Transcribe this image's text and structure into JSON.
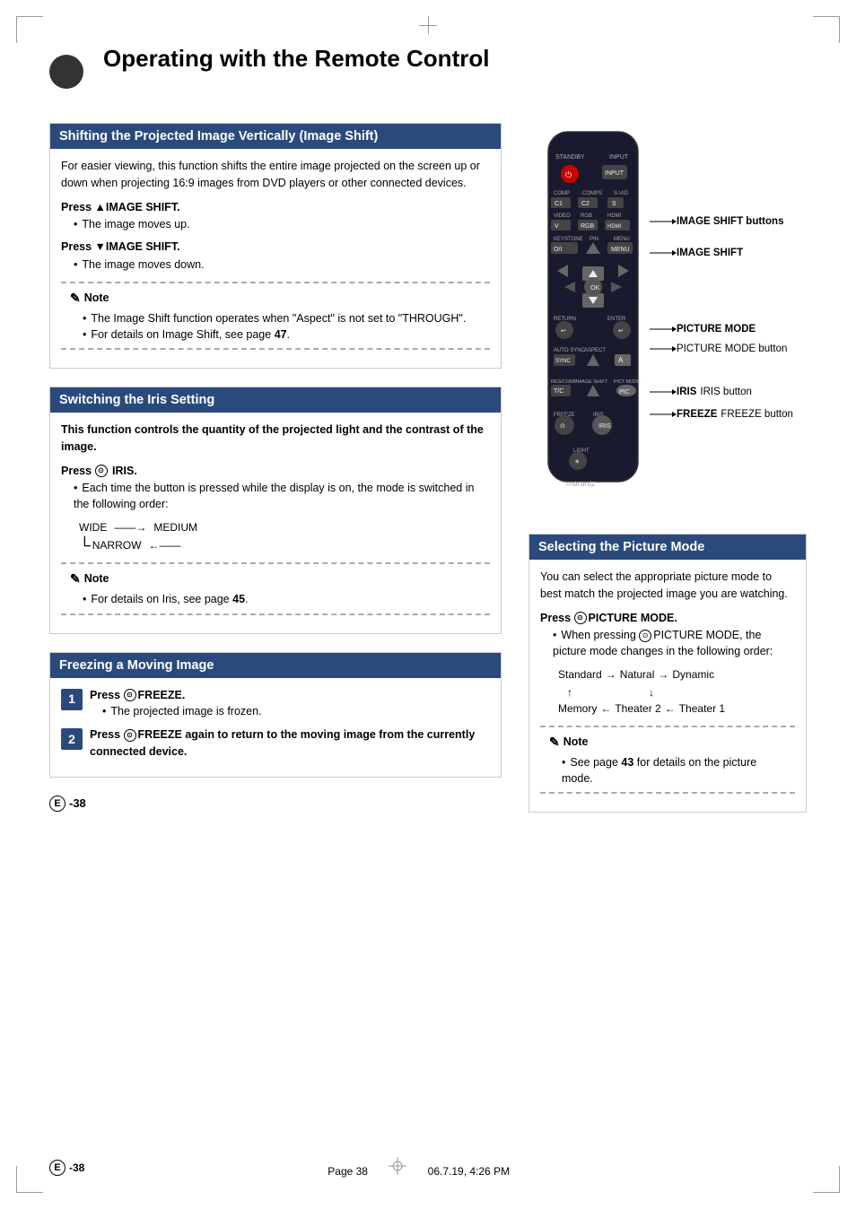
{
  "page": {
    "title": "Operating with the Remote Control",
    "page_num": "38",
    "footer_left": "E -38",
    "footer_center": "Page 38",
    "footer_right": "06.7.19, 4:26 PM"
  },
  "section_image_shift": {
    "header": "Shifting the Projected Image Vertically (Image Shift)",
    "intro": "For easier viewing, this function shifts the entire image projected on the screen up or down when projecting 16:9 images from DVD players or other connected devices.",
    "press_up_label": "Press ▲IMAGE SHIFT.",
    "press_up_bullet": "The image moves up.",
    "press_down_label": "Press ▼IMAGE SHIFT.",
    "press_down_bullet": "The image moves down.",
    "note_header": "Note",
    "note_items": [
      "The Image Shift function operates when \"Aspect\" is not set to \"THROUGH\".",
      "For details on Image Shift, see page 47."
    ]
  },
  "remote_annotations": {
    "image_shift_buttons": "IMAGE SHIFT buttons",
    "image_shift": "IMAGE SHIFT",
    "picture_mode": "PICTURE MODE button",
    "picture_mode_label": "PICTURE",
    "picture_mode_sub": "MODE button",
    "iris": "IRIS",
    "iris_button": "IRIS button",
    "freeze": "FREEZE",
    "freeze_button": "FREEZE button"
  },
  "section_iris": {
    "header": "Switching the Iris Setting",
    "intro_bold": "This function controls the quantity of the projected light and the contrast of the image.",
    "press_label": "Press",
    "press_icon": "IRIS",
    "press_suffix": "IRIS.",
    "bullet": "Each time the button is pressed while the display is on, the mode is switched in the following order:",
    "wide": "WIDE",
    "medium": "MEDIUM",
    "narrow": "NARROW",
    "note_header": "Note",
    "note_items": [
      "For details on Iris, see page 45."
    ]
  },
  "section_freeze": {
    "header": "Freezing a Moving Image",
    "step1_bold": "Press",
    "step1_icon": "FREEZE.",
    "step1_bullet": "The projected image is frozen.",
    "step2_bold": "Press",
    "step2_icon": "FREEZE",
    "step2_suffix": "again to return to the moving image from the currently connected device."
  },
  "section_picture_mode": {
    "header": "Selecting the Picture Mode",
    "intro": "You can select the appropriate picture mode to best match the projected image you are watching.",
    "press_label": "Press",
    "press_icon": "PICTURE MODE.",
    "bullet": "When pressing PICTURE MODE, the picture mode changes in the following order:",
    "modes_row1": [
      "Standard",
      "Natural",
      "Dynamic"
    ],
    "modes_row2": [
      "Memory",
      "Theater 2",
      "Theater 1"
    ],
    "note_header": "Note",
    "note_items": [
      "See page 43 for details on the picture mode."
    ]
  }
}
